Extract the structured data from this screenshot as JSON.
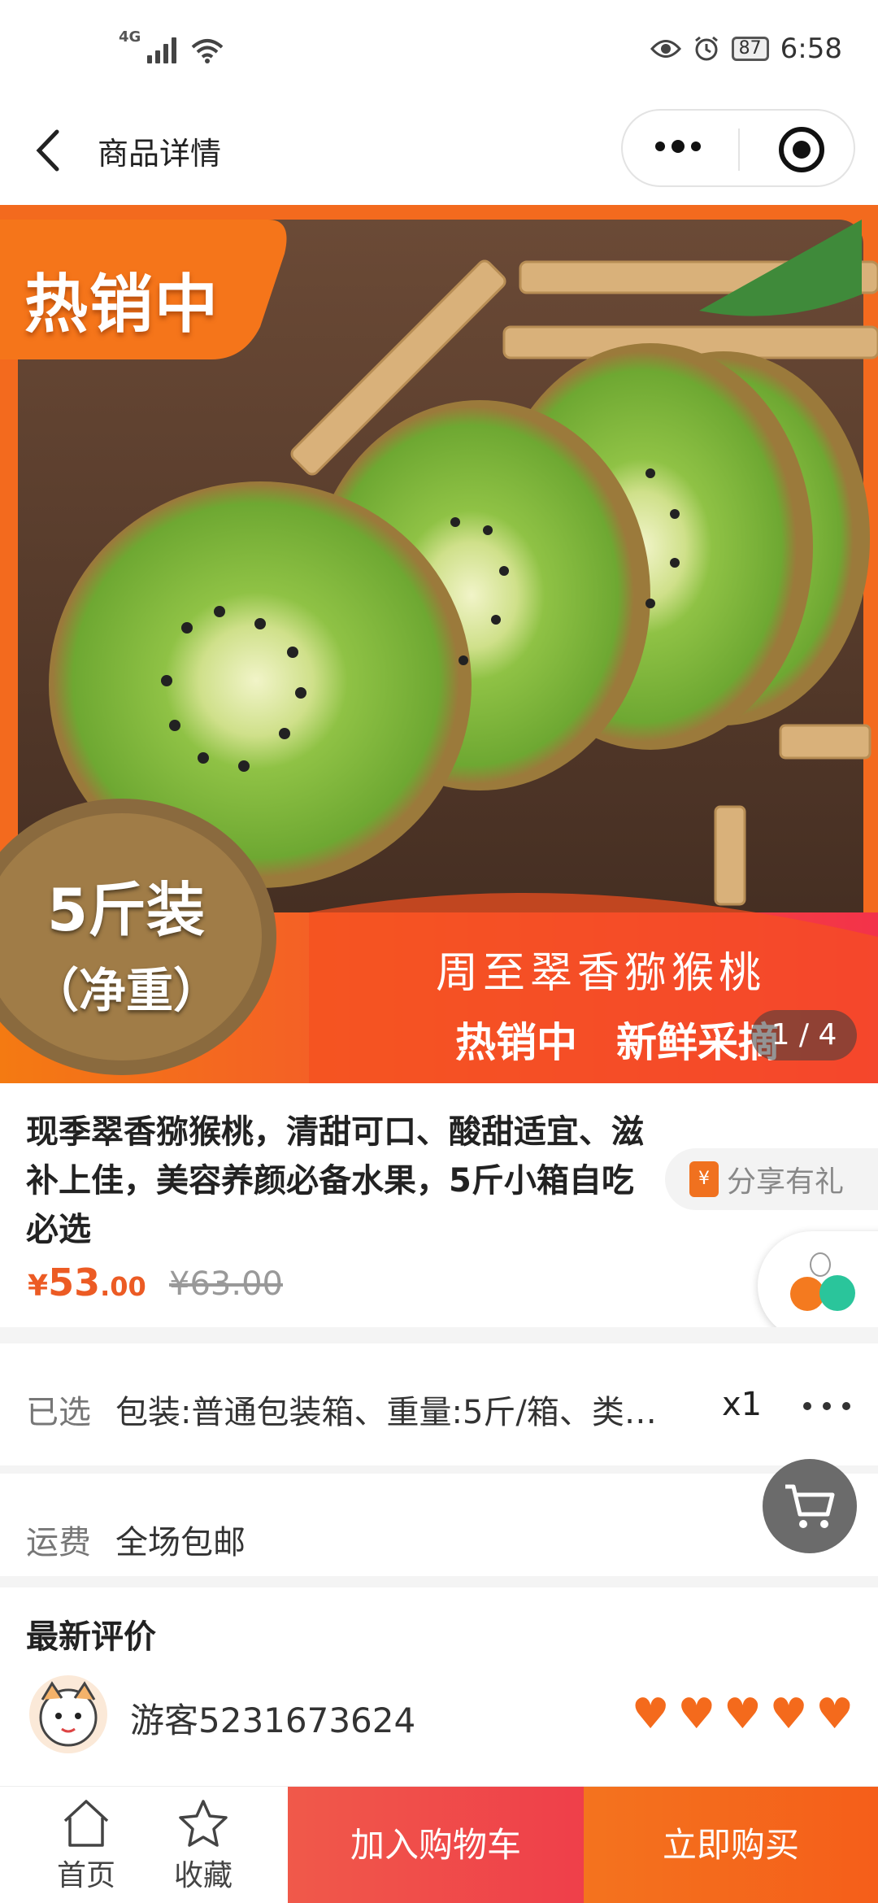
{
  "status_bar": {
    "network": "4G",
    "battery": "87",
    "time": "6:58"
  },
  "nav": {
    "title": "商品详情"
  },
  "hero": {
    "tag": "热销中",
    "weight_line1": "5斤装",
    "weight_line2": "（净重）",
    "product_name": "周至翠香猕猴桃",
    "slogan_1": "热销中",
    "slogan_2": "新鲜采摘",
    "pager": "1 / 4"
  },
  "product": {
    "title": "现季翠香猕猴桃，清甜可口、酸甜适宜、滋补上佳，美容养颜必备水果，5斤小箱自吃必选",
    "currency": "¥",
    "price_int": "53",
    "price_dec": ".00",
    "original_price": "¥63.00",
    "share_label": "分享有礼"
  },
  "selection": {
    "label": "已选",
    "value": "包装:普通包装箱、重量:5斤/箱、类…",
    "quantity": "x1"
  },
  "shipping": {
    "label": "运费",
    "value": "全场包邮"
  },
  "review": {
    "title": "最新评价",
    "user": "游客5231673624",
    "rating": 5
  },
  "bottom_bar": {
    "home_label": "首页",
    "fav_label": "收藏",
    "add_cart_label": "加入购物车",
    "buy_label": "立即购买"
  },
  "colors": {
    "accent": "#ec5b24",
    "cart_button": "#ef3f4a",
    "buy_button": "#f4731e",
    "star": "#f46a1c"
  },
  "icons": [
    "back-icon",
    "more-icon",
    "close-icon",
    "share-gift-icon",
    "cart-icon",
    "heart-star-icon",
    "home-icon",
    "star-icon"
  ]
}
